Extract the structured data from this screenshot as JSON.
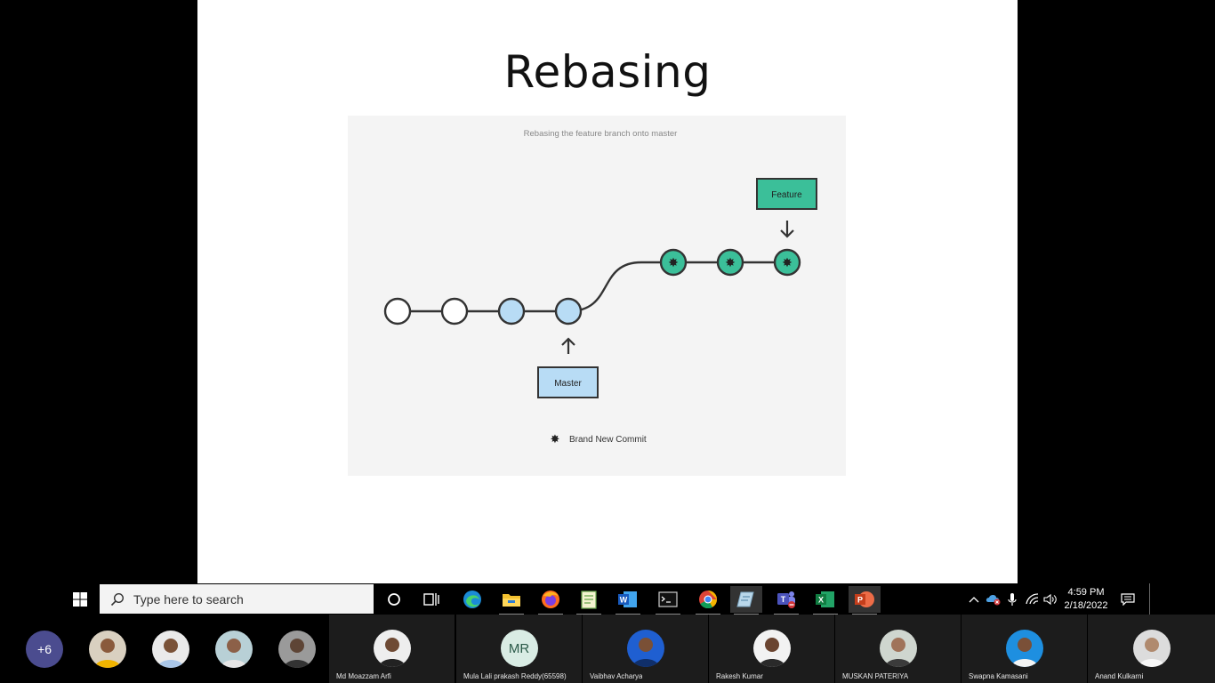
{
  "slide": {
    "title": "Rebasing",
    "diagram": {
      "caption": "Rebasing the feature branch onto master",
      "feature_label": "Feature",
      "master_label": "Master",
      "legend_label": "Brand New Commit",
      "colors": {
        "new_commit": "#3bbf99",
        "master_commit": "#b8dcf5",
        "old_commit": "#ffffff",
        "line": "#333333",
        "background": "#f4f4f4"
      }
    }
  },
  "taskbar": {
    "search_placeholder": "Type here to search",
    "apps": [
      {
        "name": "task-view-icon"
      },
      {
        "name": "edge-icon"
      },
      {
        "name": "file-explorer-icon"
      },
      {
        "name": "firefox-icon"
      },
      {
        "name": "notepad-icon"
      },
      {
        "name": "word-icon"
      },
      {
        "name": "terminal-icon"
      },
      {
        "name": "chrome-icon"
      },
      {
        "name": "notes-icon"
      },
      {
        "name": "teams-icon"
      },
      {
        "name": "excel-icon"
      },
      {
        "name": "powerpoint-icon"
      }
    ],
    "time": "4:59 PM",
    "date": "2/18/2022"
  },
  "participants": {
    "overflow_count": "+6",
    "tiles": [
      {
        "name": "Md Moazzam Arfi"
      },
      {
        "name": "Mula Lali prakash Reddy(65598)",
        "initials": "MR"
      },
      {
        "name": "Vaibhav Acharya"
      },
      {
        "name": "Rakesh Kumar"
      },
      {
        "name": "MUSKAN PATERIYA"
      },
      {
        "name": "Swapna Kamasani"
      },
      {
        "name": "Anand Kulkarni"
      }
    ]
  }
}
